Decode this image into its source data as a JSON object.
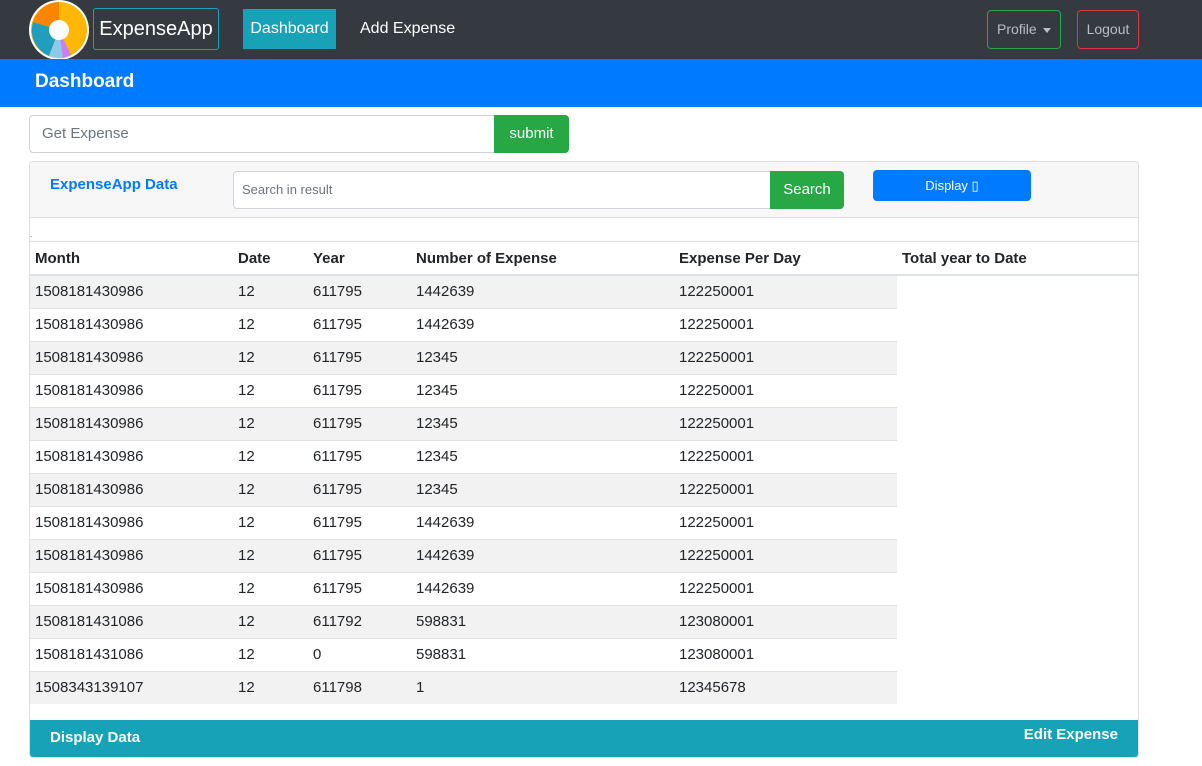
{
  "navbar": {
    "brand": "ExpenseApp",
    "links": [
      "Dashboard",
      "Add Expense"
    ],
    "profile_label": "Profile",
    "logout_label": "Logout",
    "colors": {
      "background": "#343a40",
      "active": "#17a2b8"
    }
  },
  "header": {
    "title": "Dashboard",
    "color": "#007bff"
  },
  "get_expense": {
    "placeholder": "Get Expense",
    "submit_label": "submit"
  },
  "card": {
    "title": "ExpenseApp Data",
    "search_placeholder": "Search in result",
    "search_label": "Search",
    "display_label": "Display ▯",
    "dot": "."
  },
  "table": {
    "columns": [
      "Month",
      "Date",
      "Year",
      "Number of Expense",
      "Expense Per Day",
      "Total year to Date"
    ],
    "rows": [
      [
        "1508181430986",
        "12",
        "611795",
        "1442639",
        "122250001",
        ""
      ],
      [
        "1508181430986",
        "12",
        "611795",
        "1442639",
        "122250001",
        ""
      ],
      [
        "1508181430986",
        "12",
        "611795",
        "12345",
        "122250001",
        ""
      ],
      [
        "1508181430986",
        "12",
        "611795",
        "12345",
        "122250001",
        ""
      ],
      [
        "1508181430986",
        "12",
        "611795",
        "12345",
        "122250001",
        ""
      ],
      [
        "1508181430986",
        "12",
        "611795",
        "12345",
        "122250001",
        ""
      ],
      [
        "1508181430986",
        "12",
        "611795",
        "12345",
        "122250001",
        ""
      ],
      [
        "1508181430986",
        "12",
        "611795",
        "1442639",
        "122250001",
        ""
      ],
      [
        "1508181430986",
        "12",
        "611795",
        "1442639",
        "122250001",
        ""
      ],
      [
        "1508181430986",
        "12",
        "611795",
        "1442639",
        "122250001",
        ""
      ],
      [
        "1508181431086",
        "12",
        "611792",
        "598831",
        "123080001",
        ""
      ],
      [
        "1508181431086",
        "12",
        "0",
        "598831",
        "123080001",
        ""
      ],
      [
        "1508343139107",
        "12",
        "611798",
        "1",
        "12345678",
        ""
      ]
    ]
  },
  "footer": {
    "left_label": "Display Data",
    "right_label": "Edit Expense",
    "color": "#17a2b8"
  }
}
